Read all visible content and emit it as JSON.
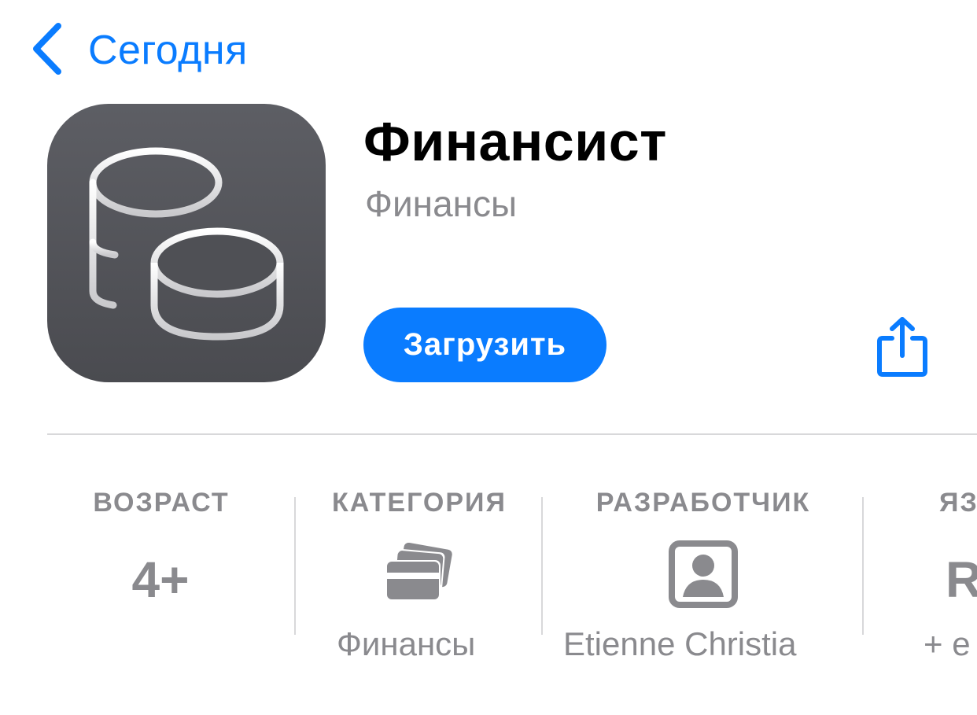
{
  "nav": {
    "back_label": "Сегодня"
  },
  "app": {
    "name": "Финансист",
    "category": "Финансы",
    "get_label": "Загрузить"
  },
  "info": {
    "age": {
      "header": "ВОЗРАСТ",
      "value": "4+"
    },
    "category": {
      "header": "КАТЕГОРИЯ",
      "value": "Финансы",
      "icon": "cards-icon"
    },
    "developer": {
      "header": "РАЗРАБОТЧИК",
      "value": "Etienne Christia",
      "icon": "person-icon"
    },
    "language": {
      "header": "ЯЗ",
      "value": "R",
      "sub": "+ е"
    }
  },
  "colors": {
    "accent": "#0a7cff",
    "gray_text": "#8a8a8e",
    "icon_bg": "#505156"
  }
}
